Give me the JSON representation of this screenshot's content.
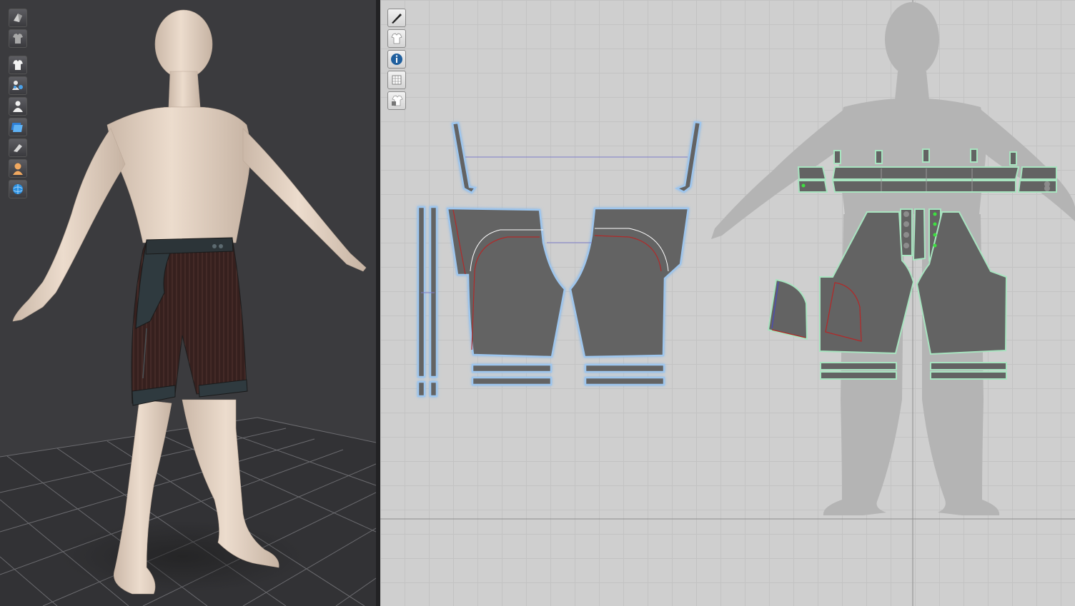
{
  "window": {
    "title": ""
  },
  "viewport_3d": {
    "toolbar": [
      {
        "name": "fabric-render-icon"
      },
      {
        "name": "garment-texture-icon"
      },
      {
        "name": "show-garment-icon"
      },
      {
        "name": "avatar-arrangement-icon"
      },
      {
        "name": "show-avatar-icon"
      },
      {
        "name": "layer-clone-icon"
      },
      {
        "name": "brush-tool-icon"
      },
      {
        "name": "avatar-skin-icon"
      },
      {
        "name": "environment-globe-icon"
      }
    ],
    "avatar": {
      "skin_color": "#e8d6c6"
    },
    "garment": {
      "main_color": "#3a2421",
      "trim_color": "#2f3a3f"
    }
  },
  "viewport_2d": {
    "toolbar": [
      {
        "name": "pattern-edit-tool-icon"
      },
      {
        "name": "show-pattern-icon"
      },
      {
        "name": "information-icon"
      },
      {
        "name": "grid-sheet-icon"
      },
      {
        "name": "lock-garment-icon"
      }
    ],
    "colors": {
      "pattern_fill": "#636363",
      "seam_glow": "#9ec6ee",
      "internal_line": "#b02a2a",
      "selected_edge": "#a8e4c0",
      "silhouette": "#b4b4b4"
    }
  }
}
